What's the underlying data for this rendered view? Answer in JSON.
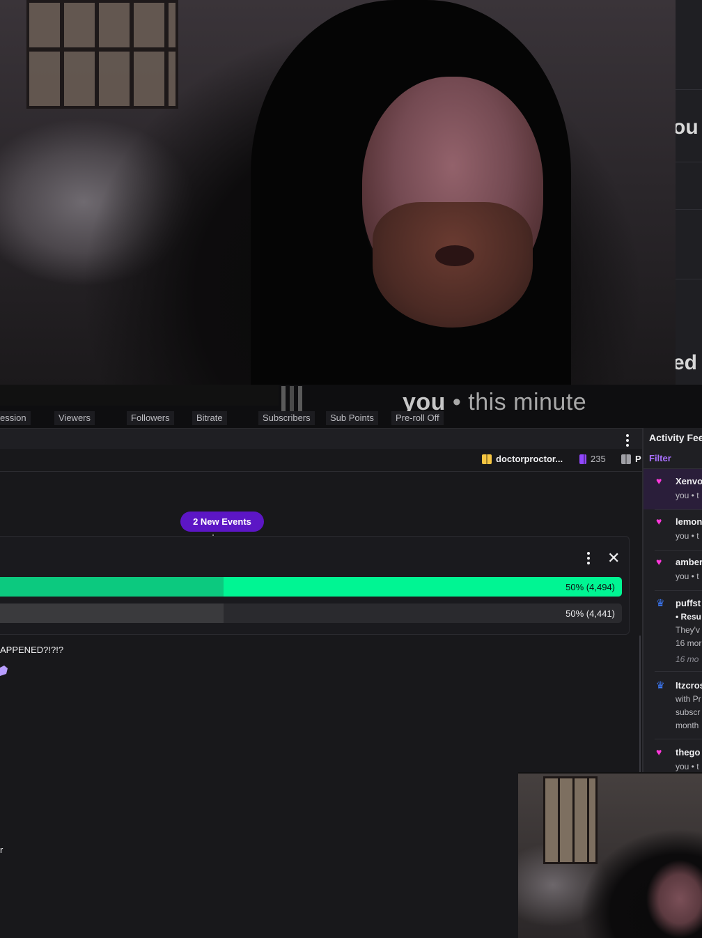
{
  "caption": {
    "you": "you",
    "separator": "•",
    "time": "this minute"
  },
  "edge_text": {
    "top": "ou",
    "bottom": "ed"
  },
  "stats": [
    "ession",
    "Viewers",
    "Followers",
    "Bitrate",
    "Subscribers",
    "Sub Points",
    "Pre-roll Off"
  ],
  "chips": {
    "gifter": "doctorproctor...",
    "count": "235",
    "partial": "P"
  },
  "new_events_label": "2 New Events",
  "poll": {
    "options": [
      {
        "label": "50% (4,494)",
        "percent": 50,
        "color": "#00f593",
        "track": "#00f593",
        "filled_part": "#0cc97f"
      },
      {
        "label": "50% (4,441)",
        "percent": 50,
        "color": "#3a3a3d",
        "track": "#2a2a2e",
        "filled_part": "#3a3a3d"
      }
    ]
  },
  "chat_lines": [
    {
      "text": "APPENED?!?!?"
    },
    {
      "text": "r"
    }
  ],
  "activity_feed": {
    "title": "Activity Fee",
    "filter": "Filter",
    "items": [
      {
        "icon": "heart-icon",
        "glyph": "♥",
        "color": "#ff38db",
        "name": "Xenvo",
        "sub": "you • t"
      },
      {
        "icon": "heart-icon",
        "glyph": "♥",
        "color": "#ff38db",
        "name": "lemon",
        "sub": "you • t"
      },
      {
        "icon": "heart-icon",
        "glyph": "♥",
        "color": "#ff38db",
        "name": "amber",
        "sub": "you • t"
      },
      {
        "icon": "crown-icon",
        "glyph": "♛",
        "color": "#3d7cff",
        "name": "puffst",
        "sub": "• Resu",
        "sub2": "They'v",
        "sub3": "16 mor",
        "sub4": "16 mo"
      },
      {
        "icon": "crown-icon",
        "glyph": "♛",
        "color": "#3d7cff",
        "name": "Itzcros",
        "sub": "with Pr",
        "sub2": "subscr",
        "sub3": "month"
      },
      {
        "icon": "heart-icon",
        "glyph": "♥",
        "color": "#ff38db",
        "name": "thego",
        "sub": "you • t"
      }
    ]
  }
}
